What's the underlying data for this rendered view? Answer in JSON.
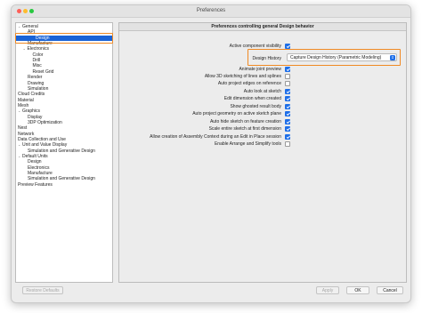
{
  "window": {
    "title": "Preferences"
  },
  "tree": {
    "items": [
      {
        "label": "General",
        "indent": 0,
        "chevron": "v"
      },
      {
        "label": "API",
        "indent": 2,
        "chevron": ""
      },
      {
        "label": "Design",
        "indent": 2,
        "chevron": "",
        "selected": true
      },
      {
        "label": "Manufacture",
        "indent": 2,
        "chevron": ""
      },
      {
        "label": "Electronics",
        "indent": 1,
        "chevron": "v"
      },
      {
        "label": "Color",
        "indent": 3,
        "chevron": ""
      },
      {
        "label": "Drill",
        "indent": 3,
        "chevron": ""
      },
      {
        "label": "Misc",
        "indent": 3,
        "chevron": ""
      },
      {
        "label": "Reset Grid",
        "indent": 3,
        "chevron": ""
      },
      {
        "label": "Render",
        "indent": 2,
        "chevron": ""
      },
      {
        "label": "Drawing",
        "indent": 2,
        "chevron": ""
      },
      {
        "label": "Simulation",
        "indent": 2,
        "chevron": ""
      },
      {
        "label": "Cloud Credits",
        "indent": 0,
        "chevron": ""
      },
      {
        "label": "Material",
        "indent": 0,
        "chevron": ""
      },
      {
        "label": "Mesh",
        "indent": 0,
        "chevron": ""
      },
      {
        "label": "Graphics",
        "indent": 0,
        "chevron": "v"
      },
      {
        "label": "Display",
        "indent": 2,
        "chevron": ""
      },
      {
        "label": "3DP Optimization",
        "indent": 2,
        "chevron": ""
      },
      {
        "label": "Nest",
        "indent": 0,
        "chevron": ""
      },
      {
        "label": "Network",
        "indent": 0,
        "chevron": ""
      },
      {
        "label": "Data Collection and Use",
        "indent": 0,
        "chevron": ""
      },
      {
        "label": "Unit and Value Display",
        "indent": 0,
        "chevron": "v"
      },
      {
        "label": "Simulation and Generative Design",
        "indent": 2,
        "chevron": ""
      },
      {
        "label": "Default Units",
        "indent": 0,
        "chevron": "v"
      },
      {
        "label": "Design",
        "indent": 2,
        "chevron": ""
      },
      {
        "label": "Electronics",
        "indent": 2,
        "chevron": ""
      },
      {
        "label": "Manufacture",
        "indent": 2,
        "chevron": ""
      },
      {
        "label": "Simulation and Generative Design",
        "indent": 2,
        "chevron": ""
      },
      {
        "label": "Preview Features",
        "indent": 0,
        "chevron": ""
      }
    ]
  },
  "prefs": {
    "header": "Preferences controlling general Design behavior",
    "design_history_label": "Design History",
    "design_history_value": "Capture Design History (Parametric Modeling)",
    "options": [
      {
        "label": "Active component visibility",
        "checked": true
      },
      {
        "label": "Animate joint preview",
        "checked": true
      },
      {
        "label": "Allow 3D sketching of lines and splines",
        "checked": false
      },
      {
        "label": "Auto project edges on reference",
        "checked": false
      },
      {
        "label": "Auto look at sketch",
        "checked": true
      },
      {
        "label": "Edit dimension when created",
        "checked": true
      },
      {
        "label": "Show ghosted result body",
        "checked": true
      },
      {
        "label": "Auto project geometry on active sketch plane",
        "checked": true
      },
      {
        "label": "Auto hide sketch on feature creation",
        "checked": true
      },
      {
        "label": "Scale entire sketch at first dimension",
        "checked": true
      },
      {
        "label": "Allow creation of Assembly Context during an Edit in Place session",
        "checked": true
      },
      {
        "label": "Enable Arrange and Simplify tools",
        "checked": false
      }
    ]
  },
  "footer": {
    "restore_defaults": "Restore Defaults",
    "apply": "Apply",
    "ok": "OK",
    "cancel": "Cancel"
  },
  "colors": {
    "accent": "#1f6fe8",
    "selection": "#1a63d6",
    "highlight_box": "#f08a24"
  }
}
